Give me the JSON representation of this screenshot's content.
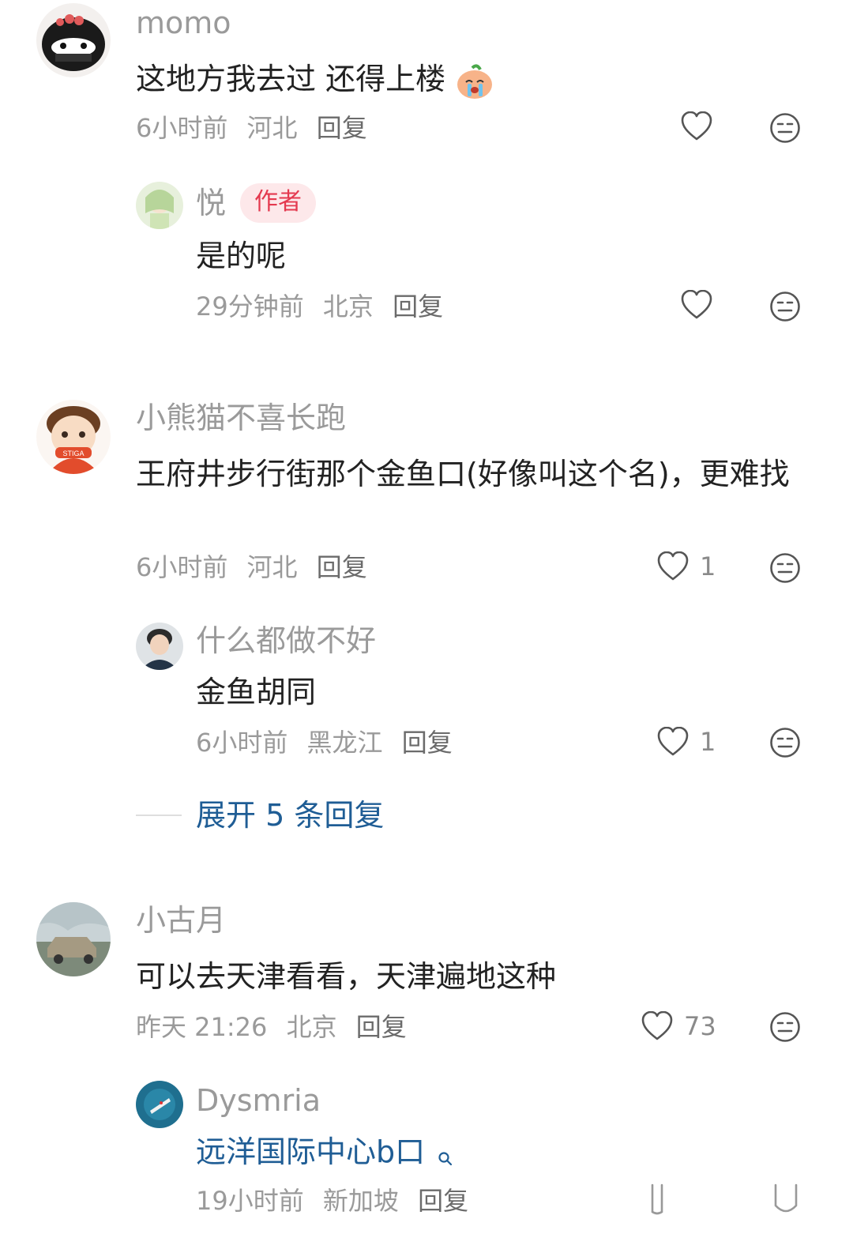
{
  "comments": [
    {
      "user": "momo",
      "text": "这地方我去过 还得上楼",
      "time": "6小时前",
      "location": "河北",
      "reply_label": "回复",
      "likes": "",
      "replies": [
        {
          "user": "悦",
          "badge": "作者",
          "text": "是的呢",
          "time": "29分钟前",
          "location": "北京",
          "reply_label": "回复",
          "likes": ""
        }
      ]
    },
    {
      "user": "小熊猫不喜长跑",
      "text": "王府井步行街那个金鱼口(好像叫这个名)，更难找",
      "time": "6小时前",
      "location": "河北",
      "reply_label": "回复",
      "likes": "1",
      "replies": [
        {
          "user": "什么都做不好",
          "text": "金鱼胡同",
          "time": "6小时前",
          "location": "黑龙江",
          "reply_label": "回复",
          "likes": "1"
        }
      ],
      "expand_label": "展开 5 条回复"
    },
    {
      "user": "小古月",
      "text": "可以去天津看看，天津遍地这种",
      "time": "昨天 21:26",
      "location": "北京",
      "reply_label": "回复",
      "likes": "73",
      "replies": [
        {
          "user": "Dysmria",
          "text": "远洋国际中心b口",
          "time": "19小时前",
          "location": "新加坡",
          "reply_label": "回复",
          "likes": ""
        }
      ]
    }
  ],
  "colors": {
    "meta": "#9a9a9a",
    "text": "#222222",
    "link": "#1f5d95",
    "badge_bg": "#fde8ea",
    "badge_fg": "#e4394f"
  },
  "icons": {
    "like": "heart-outline-icon",
    "dislike": "neutral-face-icon",
    "search": "search-icon"
  }
}
